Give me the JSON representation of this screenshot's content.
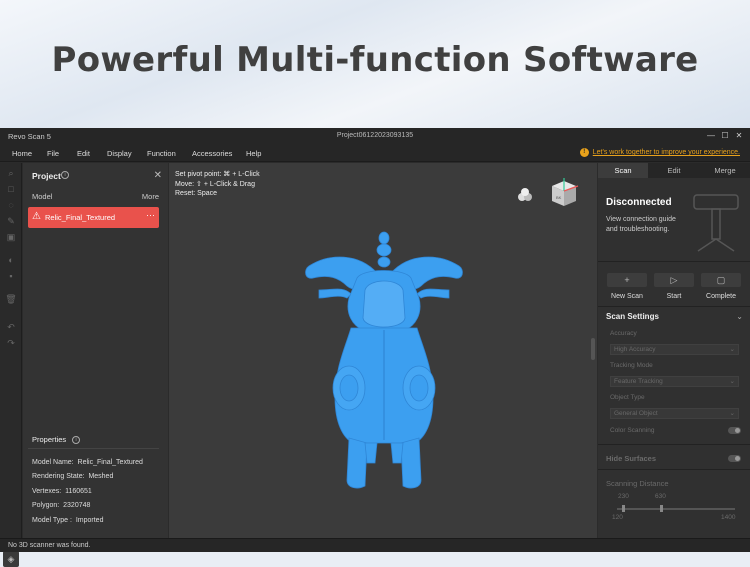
{
  "banner": {
    "title": "Powerful Multi-function Software"
  },
  "window": {
    "app_name": "Revo Scan 5",
    "project_name": "Project06122023093135",
    "minimize": "—",
    "maximize": "☐",
    "close": "✕"
  },
  "menu": {
    "items": [
      "Home",
      "File",
      "Edit",
      "Display",
      "Function",
      "Accessories",
      "Help"
    ],
    "promo": "Let's work together to improve your experience."
  },
  "project_panel": {
    "title": "Project",
    "column_model": "Model",
    "column_more": "More",
    "model_name": "Relic_Final_Textured",
    "properties_title": "Properties",
    "properties": [
      {
        "label": "Model Name:",
        "value": "Relic_Final_Textured"
      },
      {
        "label": "Rendering State:",
        "value": "Meshed"
      },
      {
        "label": "Vertexes:",
        "value": "1160651"
      },
      {
        "label": "Polygon:",
        "value": "2320748"
      },
      {
        "label": "Model Type :",
        "value": "Imported"
      }
    ]
  },
  "viewport": {
    "hints": [
      "Set pivot point: ⌘ + L-Click",
      "Move: ⇧ + L-Click & Drag",
      "Reset: Space"
    ],
    "model_color": "#3c9ff0"
  },
  "right_panel": {
    "tabs": [
      "Scan",
      "Edit",
      "Merge"
    ],
    "active_tab": "Scan",
    "status_title": "Disconnected",
    "status_desc": "View connection guide and troubleshooting.",
    "actions": [
      {
        "label": "New Scan",
        "icon": "plus-icon",
        "glyph": "+"
      },
      {
        "label": "Start",
        "icon": "play-icon",
        "glyph": "▷"
      },
      {
        "label": "Complete",
        "icon": "stop-icon",
        "glyph": "▢"
      }
    ],
    "scan_settings_title": "Scan Settings",
    "accuracy_label": "Accuracy",
    "accuracy_value": "High Accuracy",
    "tracking_label": "Tracking Mode",
    "tracking_value": "Feature Tracking",
    "object_label": "Object Type",
    "object_value": "General Object",
    "color_scanning_label": "Color Scanning",
    "hide_surfaces_label": "Hide Surfaces",
    "scanning_distance_label": "Scanning Distance",
    "distance_low": "230",
    "distance_high": "630",
    "distance_min": "120",
    "distance_max": "1400"
  },
  "status_bar": {
    "message": "No 3D scanner was found."
  },
  "colors": {
    "accent_red": "#e9524c",
    "promo_orange": "#e9a21b"
  }
}
